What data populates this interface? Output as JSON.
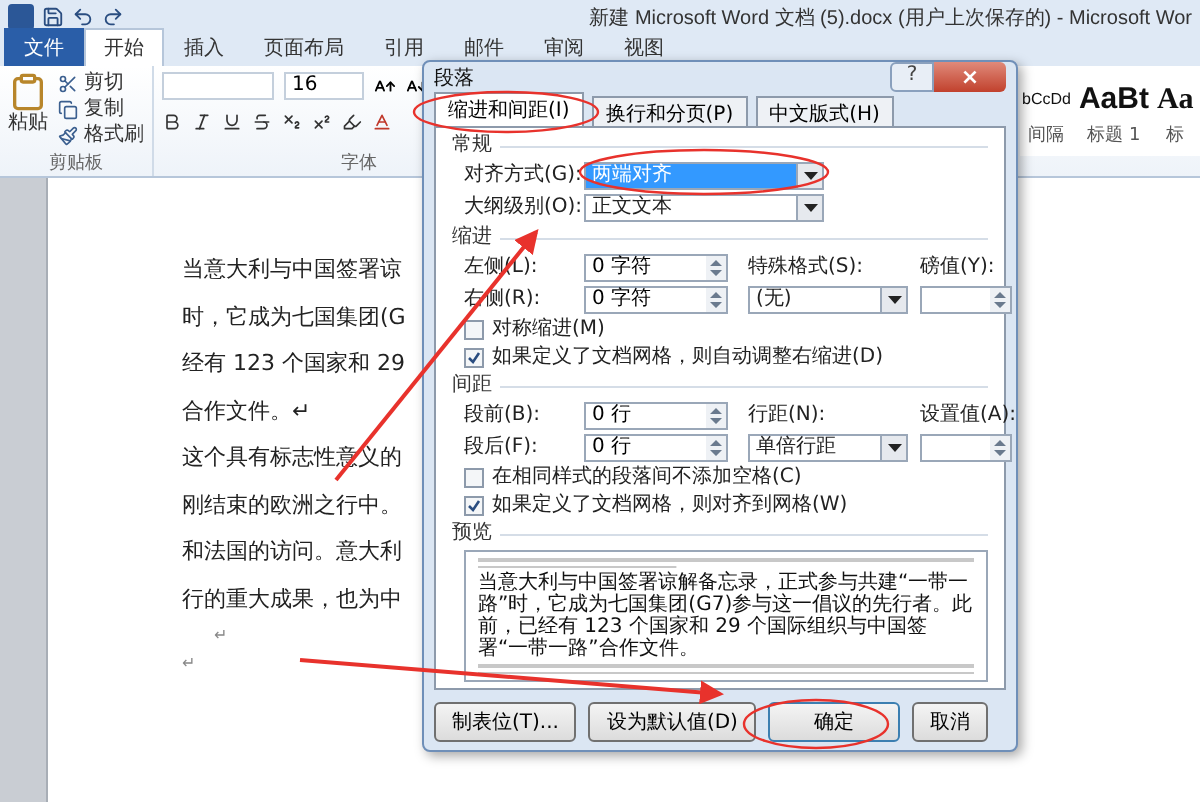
{
  "window": {
    "title": "新建 Microsoft Word 文档 (5).docx (用户上次保存的) - Microsoft Wor"
  },
  "ribbon_tabs": [
    {
      "label": "文件",
      "kind": "file",
      "selected": false
    },
    {
      "label": "开始",
      "kind": "tab",
      "selected": true
    },
    {
      "label": "插入",
      "kind": "tab",
      "selected": false
    },
    {
      "label": "页面布局",
      "kind": "tab",
      "selected": false
    },
    {
      "label": "引用",
      "kind": "tab",
      "selected": false
    },
    {
      "label": "邮件",
      "kind": "tab",
      "selected": false
    },
    {
      "label": "审阅",
      "kind": "tab",
      "selected": false
    },
    {
      "label": "视图",
      "kind": "tab",
      "selected": false
    }
  ],
  "ribbon": {
    "clipboard": {
      "paste": "粘贴",
      "items": [
        "剪切",
        "复制",
        "格式刷"
      ],
      "group_label": "剪贴板"
    },
    "font": {
      "size": "16",
      "group_label": "字体"
    },
    "styles": [
      {
        "preview": "bCcDd",
        "label": "间隔",
        "kind": "normal"
      },
      {
        "preview": "AaBt",
        "label": "标题 1",
        "kind": "big"
      },
      {
        "preview": "Aa",
        "label": "标",
        "kind": "serif"
      }
    ]
  },
  "document": {
    "lines": [
      "当意大利与中国签署谅",
      "时，它成为七国集团(G",
      "经有 123 个国家和 29",
      "合作文件。↵",
      "这个具有标志性意义的",
      "刚结束的欧洲之行中。",
      "和法国的访问。意大利",
      "行的重大成果，也为中"
    ],
    "marks": [
      "↵",
      "↵"
    ]
  },
  "dialog": {
    "title": "段落",
    "help": "?",
    "close": "×",
    "tabs": [
      {
        "label": "缩进和间距(I)",
        "selected": true
      },
      {
        "label": "换行和分页(P)",
        "selected": false
      },
      {
        "label": "中文版式(H)",
        "selected": false
      }
    ],
    "general": {
      "heading": "常规",
      "alignment": {
        "label": "对齐方式(G):",
        "value": "两端对齐",
        "highlighted": true
      },
      "outline": {
        "label": "大纲级别(O):",
        "value": "正文文本",
        "highlighted": false
      }
    },
    "indent": {
      "heading": "缩进",
      "left": {
        "label": "左侧(L):",
        "value": "0 字符"
      },
      "right": {
        "label": "右侧(R):",
        "value": "0 字符"
      },
      "special": {
        "label": "特殊格式(S):",
        "value": "(无)"
      },
      "by": {
        "label": "磅值(Y):"
      },
      "checks": [
        {
          "label": "对称缩进(M)",
          "checked": false
        },
        {
          "label": "如果定义了文档网格，则自动调整右缩进(D)",
          "checked": true
        }
      ]
    },
    "spacing": {
      "heading": "间距",
      "before": {
        "label": "段前(B):",
        "value": "0 行"
      },
      "after": {
        "label": "段后(F):",
        "value": "0 行"
      },
      "line": {
        "label": "行距(N):",
        "value": "单倍行距"
      },
      "at": {
        "label": "设置值(A):"
      },
      "checks": [
        {
          "label": "在相同样式的段落间不添加空格(C)",
          "checked": false
        },
        {
          "label": "如果定义了文档网格，则对齐到网格(W)",
          "checked": true
        }
      ]
    },
    "preview": {
      "heading": "预览",
      "text": "当意大利与中国签署谅解备忘录，正式参与共建“一带一路”时，它成为七国集团(G7)参与这一倡议的先行者。此前，已经有 123 个国家和 29 个国际组织与中国签署“一带一路”合作文件。"
    },
    "buttons": [
      {
        "label": "制表位(T)...",
        "selected": false
      },
      {
        "label": "设为默认值(D)",
        "selected": false
      },
      {
        "label": "确定",
        "selected": true
      },
      {
        "label": "取消",
        "selected": false
      }
    ]
  }
}
